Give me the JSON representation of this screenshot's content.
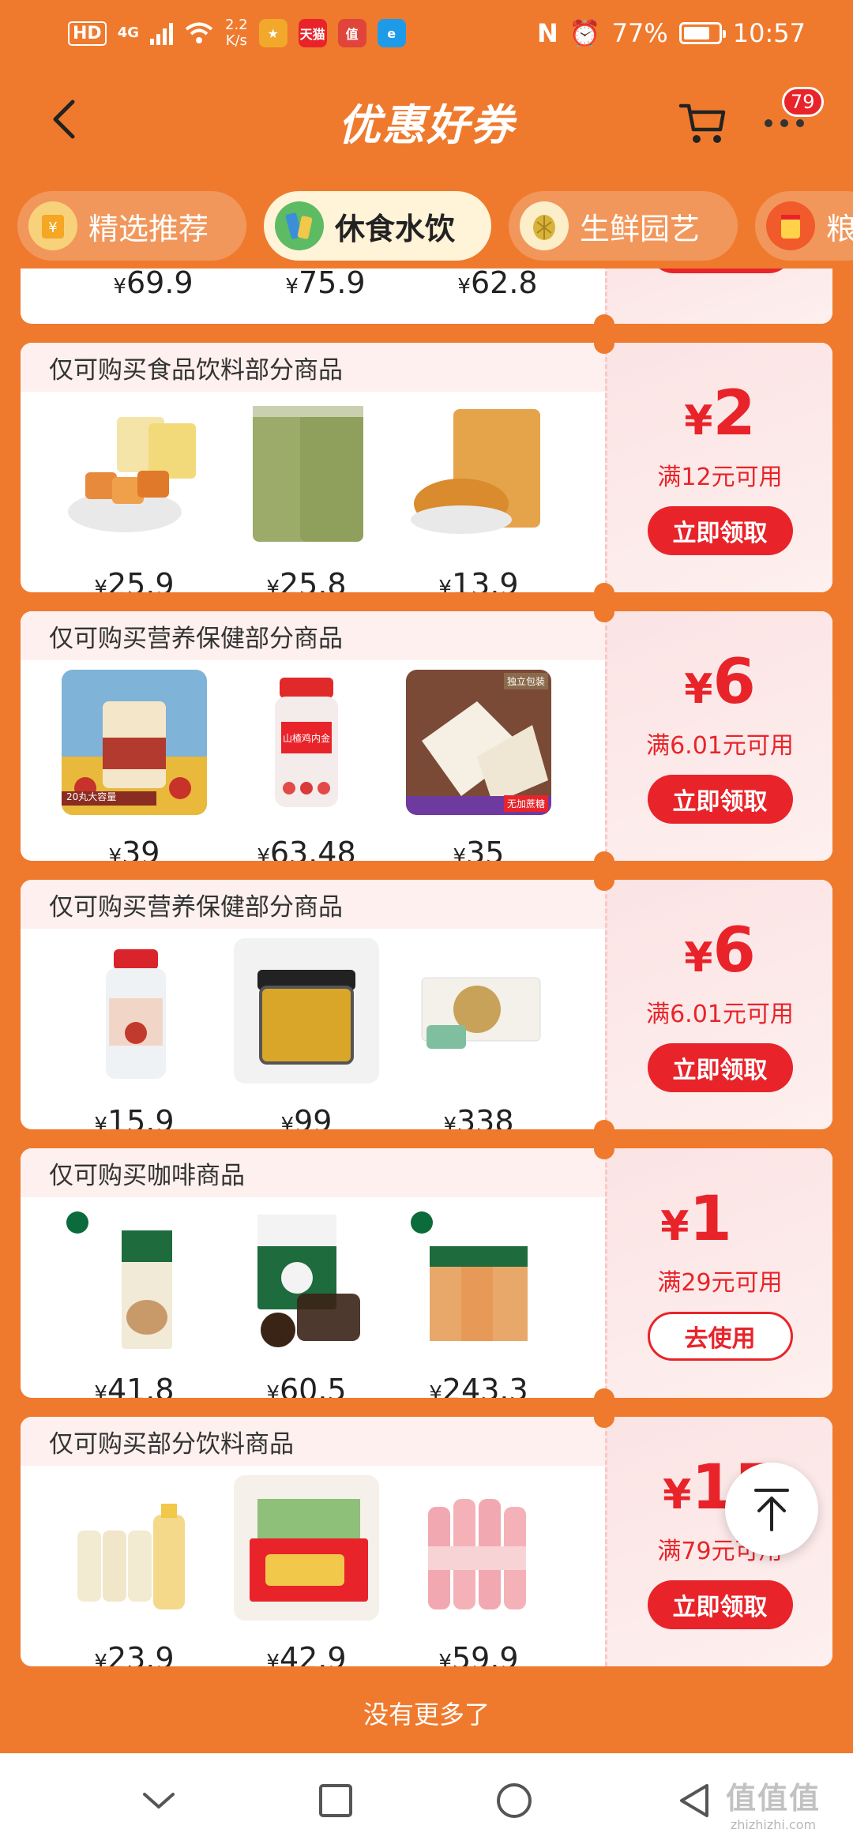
{
  "status_bar": {
    "hd": "HD",
    "network": "4G",
    "speed_value": "2.2",
    "speed_unit": "K/s",
    "app_icons": [
      "app-icon-1",
      "天猫",
      "值",
      "e"
    ],
    "battery": "77%",
    "battery_level": 0.77,
    "time": "10:57"
  },
  "header": {
    "title": "优惠好券",
    "cart_badge": "79"
  },
  "tabs": [
    {
      "label": "精选推荐",
      "icon": "coupon-icon",
      "active": false
    },
    {
      "label": "休食水饮",
      "icon": "snack-drink-icon",
      "active": true
    },
    {
      "label": "生鲜园艺",
      "icon": "durian-icon",
      "active": false
    },
    {
      "label": "粮",
      "icon": "grain-icon",
      "active": false
    }
  ],
  "coupons": [
    {
      "prices": [
        "69.9",
        "75.9",
        "62.8"
      ]
    },
    {
      "title": "仅可购买食品饮料部分商品",
      "amount": "2",
      "condition": "满12元可用",
      "action": "立即领取",
      "prices": [
        "25.9",
        "25.8",
        "13.9"
      ]
    },
    {
      "title": "仅可购买营养保健部分商品",
      "amount": "6",
      "condition": "满6.01元可用",
      "action": "立即领取",
      "prices": [
        "39",
        "63.48",
        "35"
      ]
    },
    {
      "title": "仅可购买营养保健部分商品",
      "amount": "6",
      "condition": "满6.01元可用",
      "action": "立即领取",
      "prices": [
        "15.9",
        "99",
        "338"
      ]
    },
    {
      "title": "仅可购买咖啡商品",
      "amount": "1",
      "condition": "满29元可用",
      "action": "去使用",
      "prices": [
        "41.8",
        "60.5",
        "243.3"
      ]
    },
    {
      "title": "仅可购买部分饮料商品",
      "amount": "15",
      "condition": "满79元可用",
      "action": "立即领取",
      "prices": [
        "23.9",
        "42.9",
        "59.9"
      ]
    }
  ],
  "product_labels": {
    "hawthorn_jar": "20丸大容量",
    "gummy_brand": "山楂鸡内金",
    "nougat_tag": "独立包装",
    "nougat_badge": "无加蔗糖"
  },
  "currency": "¥",
  "end_text": "没有更多了",
  "watermark": {
    "logo": "值值值",
    "url": "zhizhizhi.com"
  },
  "colors": {
    "background": "#ef7a2d",
    "accent_red": "#e8242a",
    "coupon_tint": "#fdf0ee"
  }
}
